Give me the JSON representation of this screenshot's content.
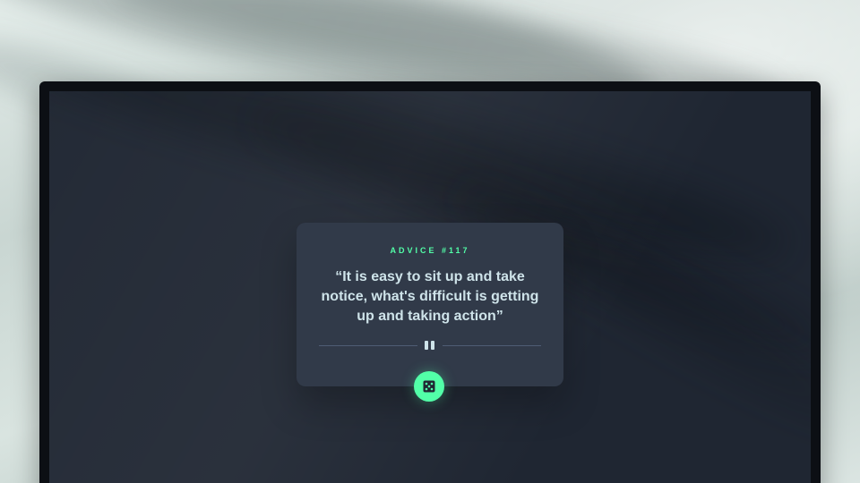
{
  "advice": {
    "id_label": "ADVICE #117",
    "quote": "“It is easy to sit up and take notice, what's difficult is getting up and taking action”"
  },
  "icons": {
    "divider": "pause-icon",
    "button": "dice-icon"
  },
  "colors": {
    "accent": "#52ffa8",
    "card": "#313a49",
    "screen": "#1f2632",
    "quote_text": "#cee3e9"
  }
}
